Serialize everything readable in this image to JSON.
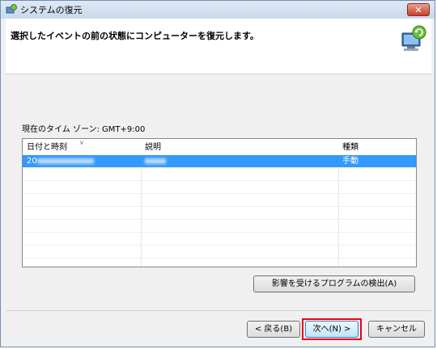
{
  "window": {
    "title": "システムの復元",
    "close_label": "✕"
  },
  "header": {
    "title": "選択したイベントの前の状態にコンピューターを復元します。"
  },
  "timezone": {
    "label": "現在のタイム ゾーン: GMT+9:00"
  },
  "table": {
    "columns": [
      "日付と時刻",
      "説明",
      "種類"
    ],
    "rows": [
      {
        "date": "20",
        "description": "",
        "type": "手動",
        "selected": true
      }
    ]
  },
  "buttons": {
    "scan": "影響を受けるプログラムの検出(A)",
    "back": "< 戻る(B)",
    "next": "次へ(N) >",
    "cancel": "キャンセル"
  },
  "colors": {
    "selection": "#3399ff",
    "highlight_border": "#e8001c"
  }
}
